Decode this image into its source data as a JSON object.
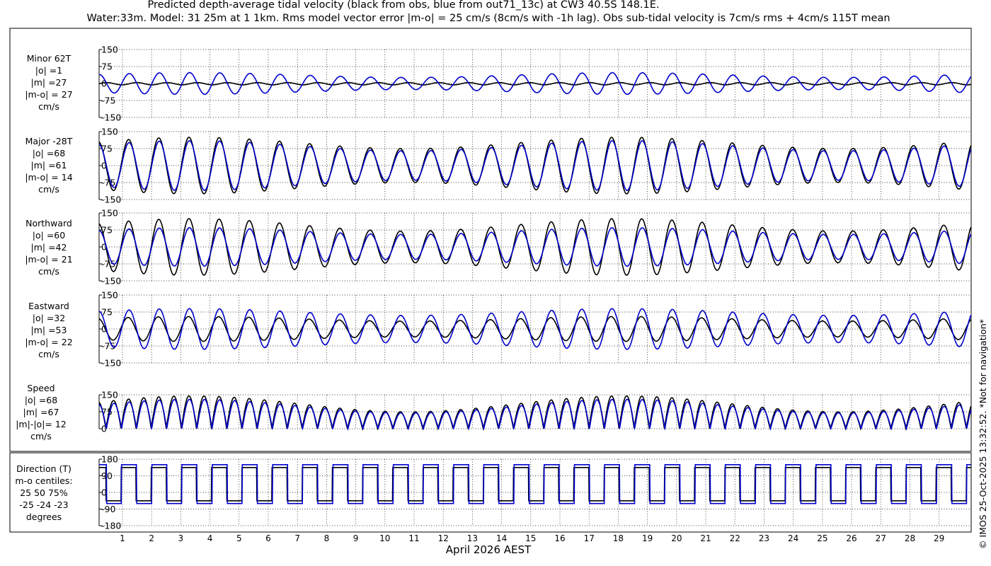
{
  "title_line1": "Predicted depth-average tidal velocity (black from obs, blue from out71_13c) at CW3 40.5S 148.1E.",
  "title_line2": "Water:33m. Model: 31 25m at 1 1km. Rms model vector error |m-o| = 25 cm/s (8cm/s with -1h lag). Obs sub-tidal velocity is 7cm/s rms + 4cm/s 115T mean",
  "xlabel": "April 2026 AEST",
  "credit": "© IMOS 25-Oct-2025 13:32:52. *Not for navigation*",
  "colors": {
    "obs": "#000000",
    "model": "#0000cc"
  },
  "panels": [
    {
      "id": "minor",
      "label_lines": [
        "Minor 62T",
        "|o| =1",
        "|m| =27",
        "|m-o| = 27",
        "cm/s"
      ]
    },
    {
      "id": "major",
      "label_lines": [
        "Major -28T",
        "|o| =68",
        "|m| =61",
        "|m-o| = 14",
        "cm/s"
      ]
    },
    {
      "id": "north",
      "label_lines": [
        "Northward",
        "|o| =60",
        "|m| =42",
        "|m-o| = 21",
        "cm/s"
      ]
    },
    {
      "id": "east",
      "label_lines": [
        "Eastward",
        "|o| =32",
        "|m| =53",
        "|m-o| = 22",
        "cm/s"
      ]
    },
    {
      "id": "speed",
      "label_lines": [
        "Speed",
        "|o| =68",
        "|m| =67",
        "|m|-|o|= 12",
        "cm/s"
      ]
    },
    {
      "id": "dir",
      "label_lines": [
        "Direction (T)",
        "m-o centiles:",
        "25  50  75%",
        "-25 -24 -23",
        "degrees"
      ]
    }
  ],
  "chart_data": [
    {
      "type": "line",
      "panel": "minor",
      "x_unit": "day of April 2026",
      "xlim": [
        0.2,
        30.1
      ],
      "ylim": [
        -150,
        150
      ],
      "yticks": [
        -150,
        -75,
        0,
        75,
        150
      ],
      "grid": true,
      "series": [
        {
          "name": "obs",
          "color": "#000000",
          "mean": -1,
          "amplitude": 5
        },
        {
          "name": "model",
          "color": "#0000cc",
          "amplitude_range": [
            27,
            48
          ]
        }
      ]
    },
    {
      "type": "line",
      "panel": "major",
      "x_unit": "day of April 2026",
      "xlim": [
        0.2,
        30.1
      ],
      "ylim": [
        -150,
        150
      ],
      "yticks": [
        -150,
        -75,
        0,
        75,
        150
      ],
      "grid": true,
      "series": [
        {
          "name": "obs",
          "color": "#000000",
          "amplitude_range": [
            75,
            125
          ]
        },
        {
          "name": "model",
          "color": "#0000cc",
          "amplitude_range": [
            65,
            110
          ]
        }
      ]
    },
    {
      "type": "line",
      "panel": "north",
      "x_unit": "day of April 2026",
      "xlim": [
        0.2,
        30.1
      ],
      "ylim": [
        -150,
        150
      ],
      "yticks": [
        -150,
        -75,
        0,
        75,
        150
      ],
      "grid": true,
      "series": [
        {
          "name": "obs",
          "color": "#000000",
          "amplitude_range": [
            70,
            125
          ]
        },
        {
          "name": "model",
          "color": "#0000cc",
          "amplitude_range": [
            55,
            85
          ]
        }
      ]
    },
    {
      "type": "line",
      "panel": "east",
      "x_unit": "day of April 2026",
      "xlim": [
        0.2,
        30.1
      ],
      "ylim": [
        -150,
        150
      ],
      "yticks": [
        -150,
        -75,
        0,
        75,
        150
      ],
      "grid": true,
      "series": [
        {
          "name": "obs",
          "color": "#000000",
          "amplitude_range": [
            35,
            55
          ]
        },
        {
          "name": "model",
          "color": "#0000cc",
          "amplitude_range": [
            60,
            90
          ]
        }
      ]
    },
    {
      "type": "line",
      "panel": "speed",
      "x_unit": "day of April 2026",
      "xlim": [
        0.2,
        30.1
      ],
      "ylim": [
        0,
        150
      ],
      "yticks": [
        0,
        75,
        150
      ],
      "grid": true,
      "series": [
        {
          "name": "obs",
          "color": "#000000",
          "peak_range": [
            75,
            145
          ]
        },
        {
          "name": "model",
          "color": "#0000cc",
          "peak_range": [
            70,
            130
          ]
        }
      ]
    },
    {
      "type": "line",
      "panel": "dir",
      "x_unit": "day of April 2026",
      "xlim": [
        0.2,
        30.1
      ],
      "ylim": [
        -180,
        180
      ],
      "yticks": [
        -180,
        -90,
        0,
        90,
        180
      ],
      "grid": true,
      "series": [
        {
          "name": "obs",
          "color": "#000000",
          "levels": [
            135,
            -45
          ]
        },
        {
          "name": "model",
          "color": "#0000cc",
          "levels": [
            150,
            -60
          ]
        }
      ]
    }
  ],
  "x_tick_labels": [
    "1",
    "2",
    "3",
    "4",
    "5",
    "6",
    "7",
    "8",
    "9",
    "10",
    "11",
    "12",
    "13",
    "14",
    "15",
    "16",
    "17",
    "18",
    "19",
    "20",
    "21",
    "22",
    "23",
    "24",
    "25",
    "26",
    "27",
    "28",
    "29"
  ]
}
